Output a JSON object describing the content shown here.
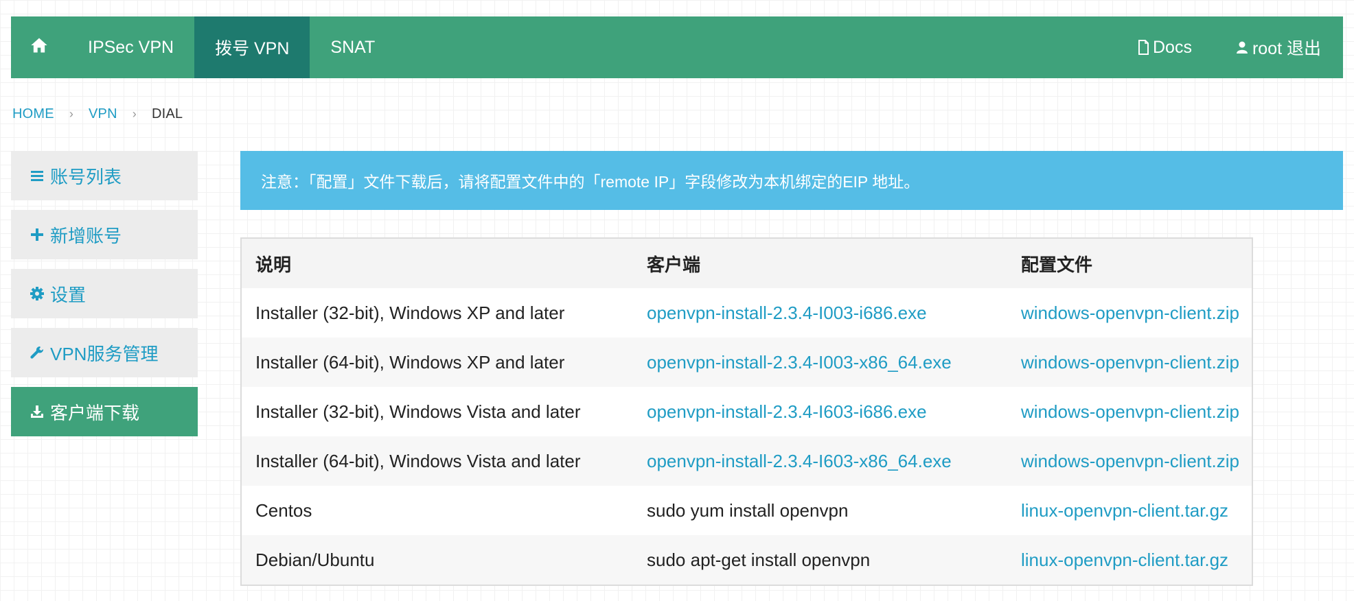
{
  "navbar": {
    "home_icon": "home-icon",
    "items": [
      {
        "label": "IPSec VPN",
        "active": false
      },
      {
        "label": "拨号 VPN",
        "active": true
      },
      {
        "label": "SNAT",
        "active": false
      }
    ],
    "docs_icon": "document-icon",
    "docs_label": "Docs",
    "user_icon": "user-icon",
    "user_label": "root 退出"
  },
  "breadcrumb": {
    "items": [
      "HOME",
      "VPN"
    ],
    "separator": "›",
    "current": "DIAL"
  },
  "sidebar": {
    "items": [
      {
        "icon": "list-icon",
        "label": "账号列表",
        "active": false
      },
      {
        "icon": "plus-icon",
        "label": "新增账号",
        "active": false
      },
      {
        "icon": "gear-icon",
        "label": "设置",
        "active": false
      },
      {
        "icon": "wrench-icon",
        "label": "VPN服务管理",
        "active": false
      },
      {
        "icon": "download-icon",
        "label": "客户端下载",
        "active": true
      }
    ]
  },
  "alert": {
    "text": "注意：「配置」文件下载后，请将配置文件中的「remote IP」字段修改为本机绑定的EIP 地址。"
  },
  "table": {
    "headers": [
      "说明",
      "客户端",
      "配置文件"
    ],
    "rows": [
      {
        "desc": "Installer (32-bit), Windows XP and later",
        "client": "openvpn-install-2.3.4-I003-i686.exe",
        "config": "windows-openvpn-client.zip"
      },
      {
        "desc": "Installer (64-bit), Windows XP and later",
        "client": "openvpn-install-2.3.4-I003-x86_64.exe",
        "config": "windows-openvpn-client.zip"
      },
      {
        "desc": "Installer (32-bit), Windows Vista and later",
        "client": "openvpn-install-2.3.4-I603-i686.exe",
        "config": "windows-openvpn-client.zip"
      },
      {
        "desc": "Installer (64-bit), Windows Vista and later",
        "client": "openvpn-install-2.3.4-I603-x86_64.exe",
        "config": "windows-openvpn-client.zip"
      },
      {
        "desc": "Centos",
        "client": "sudo yum install openvpn",
        "config": "linux-openvpn-client.tar.gz"
      },
      {
        "desc": "Debian/Ubuntu",
        "client": "sudo apt-get install openvpn",
        "config": "linux-openvpn-client.tar.gz"
      }
    ]
  },
  "colors": {
    "brand_green": "#3fa27b",
    "active_tab": "#1e7a6e",
    "link_blue": "#1f9cc4",
    "alert_bg": "#55bde6"
  }
}
